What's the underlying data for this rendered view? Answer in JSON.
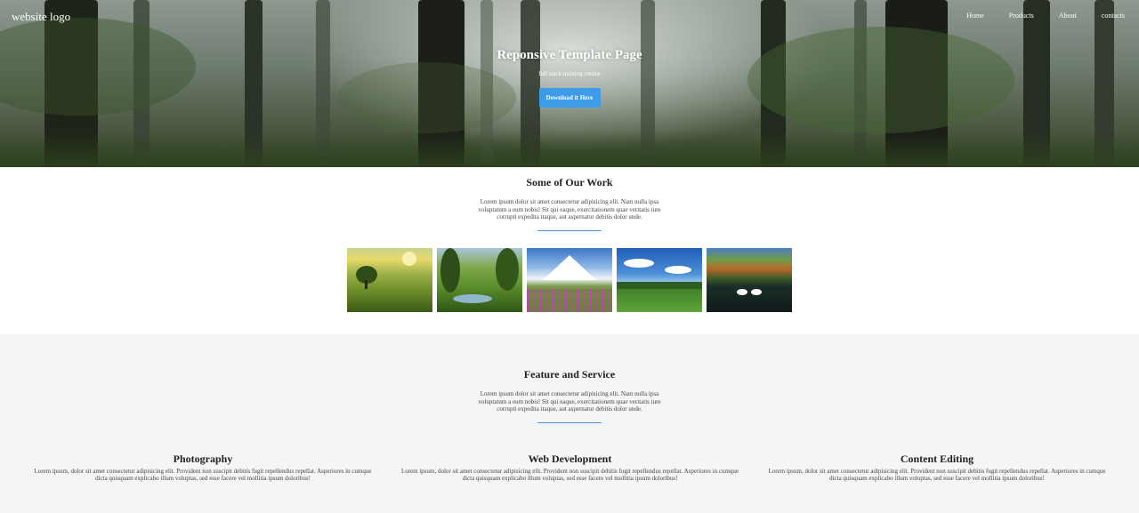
{
  "nav": {
    "logo": "website logo",
    "links": [
      "Home",
      "Products",
      "About",
      "contacts"
    ]
  },
  "hero": {
    "title": "Reponsive Template Page",
    "subtitle": "full stack training course",
    "button_label": "Download it Here"
  },
  "work": {
    "title": "Some of Our Work",
    "text": "Lorem ipsum dolor sit amet consectetur adipisicing elit. Nam nulla ipsa voluptatum a eum nobis! Sit qui eaque, exercitationem quae veritatis iure corrupti expedita itaque, aut aspernatur debitis dolor unde.",
    "images": [
      "green hills with tree",
      "forest stream valley",
      "snowy mountain flower field",
      "blue sky meadow",
      "swans on lake"
    ]
  },
  "features": {
    "title": "Feature and Service",
    "text": "Lorem ipsum dolor sit amet consectetur adipisicing elit. Nam nulla ipsa voluptatum a eum nobis! Sit qui eaque, exercitationem quae veritatis iure corrupti expedita itaque, aut aspernatur debitis dolor unde.",
    "items": [
      {
        "title": "Photography",
        "text": "Lorem ipsum, dolor sit amet consectetur adipisicing elit. Provident non suscipit debitis fugit repellendus repellat. Asperiores in cumque dicta quisquam explicabo illum voluptas, sed esse facere vel mollitia ipsum doloribus!"
      },
      {
        "title": "Web Development",
        "text": "Lorem ipsum, dolor sit amet consectetur adipisicing elit. Provident non suscipit debitis fugit repellendus repellat. Asperiores in cumque dicta quisquam explicabo illum voluptas, sed esse facere vel mollitia ipsum doloribus!"
      },
      {
        "title": "Content Editing",
        "text": "Lorem ipsum, dolor sit amet consectetur adipisicing elit. Provident non suscipit debitis fugit repellendus repellat. Asperiores in cumque dicta quisquam explicabo illum voluptas, sed esse facere vel mollitia ipsum doloribus!"
      }
    ]
  },
  "colors": {
    "accent": "#3d9be9",
    "divider": "#4a90d9",
    "section_bg": "#f5f5f5"
  }
}
